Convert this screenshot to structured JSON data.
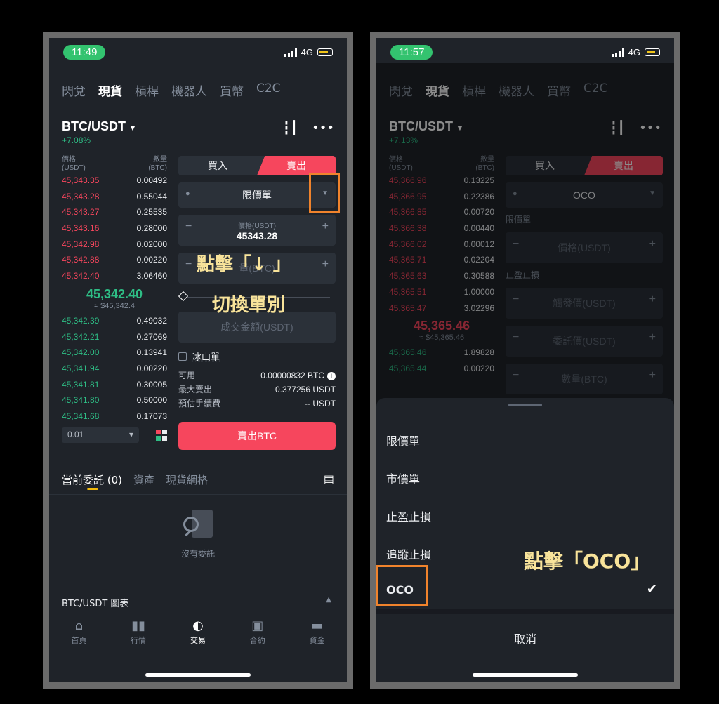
{
  "left": {
    "status": {
      "time": "11:49",
      "network": "4G"
    },
    "nav": [
      "閃兌",
      "現貨",
      "槓桿",
      "機器人",
      "買幣",
      "C2C"
    ],
    "pair": "BTC/USDT",
    "change": "+7.08%",
    "orderbook": {
      "price_header": "價格",
      "price_unit": "(USDT)",
      "qty_header": "數量",
      "qty_unit": "(BTC)",
      "asks": [
        {
          "p": "45,343.35",
          "q": "0.00492"
        },
        {
          "p": "45,343.28",
          "q": "0.55044"
        },
        {
          "p": "45,343.27",
          "q": "0.25535"
        },
        {
          "p": "45,343.16",
          "q": "0.28000"
        },
        {
          "p": "45,342.98",
          "q": "0.02000"
        },
        {
          "p": "45,342.88",
          "q": "0.00220"
        },
        {
          "p": "45,342.40",
          "q": "3.06460"
        }
      ],
      "mid_price": "45,342.40",
      "mid_usd": "≈ $45,342.4",
      "bids": [
        {
          "p": "45,342.39",
          "q": "0.49032"
        },
        {
          "p": "45,342.21",
          "q": "0.27069"
        },
        {
          "p": "45,342.00",
          "q": "0.13941"
        },
        {
          "p": "45,341.94",
          "q": "0.00220"
        },
        {
          "p": "45,341.81",
          "q": "0.30005"
        },
        {
          "p": "45,341.80",
          "q": "0.50000"
        },
        {
          "p": "45,341.68",
          "q": "0.17073"
        }
      ],
      "depth": "0.01"
    },
    "form": {
      "buy": "買入",
      "sell": "賣出",
      "order_type": "限價單",
      "price_label": "價格(USDT)",
      "price_value": "45343.28",
      "qty_placeholder": "量(BTC)",
      "total_placeholder": "成交金額(USDT)",
      "iceberg": "冰山單",
      "available_label": "可用",
      "available_value": "0.00000832 BTC",
      "max_sell_label": "最大賣出",
      "max_sell_value": "0.377256 USDT",
      "fee_label": "預估手續費",
      "fee_value": "-- USDT",
      "submit": "賣出BTC"
    },
    "orders_tabs": [
      "當前委託 (0)",
      "資產",
      "現貨網格"
    ],
    "empty_text": "沒有委託",
    "chart_bar": "BTC/USDT 圖表",
    "tabbar": [
      "首頁",
      "行情",
      "交易",
      "合約",
      "資金"
    ],
    "annotation_1": "點擊「↓ 」",
    "annotation_2": "切換單別"
  },
  "right": {
    "status": {
      "time": "11:57",
      "network": "4G"
    },
    "nav": [
      "閃兌",
      "現貨",
      "槓桿",
      "機器人",
      "買幣",
      "C2C"
    ],
    "pair": "BTC/USDT",
    "change": "+7.13%",
    "orderbook": {
      "price_header": "價格",
      "price_unit": "(USDT)",
      "qty_header": "數量",
      "qty_unit": "(BTC)",
      "asks": [
        {
          "p": "45,366.96",
          "q": "0.13225"
        },
        {
          "p": "45,366.95",
          "q": "0.22386"
        },
        {
          "p": "45,366.85",
          "q": "0.00720"
        },
        {
          "p": "45,366.38",
          "q": "0.00440"
        },
        {
          "p": "45,366.02",
          "q": "0.00012"
        },
        {
          "p": "45,365.71",
          "q": "0.02204"
        },
        {
          "p": "45,365.63",
          "q": "0.30588"
        },
        {
          "p": "45,365.51",
          "q": "1.00000"
        },
        {
          "p": "45,365.47",
          "q": "3.02296"
        }
      ],
      "mid_price": "45,365.46",
      "mid_usd": "≈ $45,365.46",
      "bids": [
        {
          "p": "45,365.46",
          "q": "1.89828"
        },
        {
          "p": "45,365.44",
          "q": "0.00220"
        }
      ]
    },
    "form": {
      "buy": "買入",
      "sell": "賣出",
      "order_type": "OCO",
      "limit_label": "限價單",
      "price_placeholder": "價格(USDT)",
      "tpsl_label": "止盈止損",
      "trigger_placeholder": "觸發價(USDT)",
      "order_price_placeholder": "委託價(USDT)",
      "qty_placeholder": "數量(BTC)"
    },
    "sheet": {
      "options": [
        "限價單",
        "市價單",
        "止盈止損",
        "追蹤止損",
        "OCO"
      ],
      "selected": "OCO",
      "cancel": "取消"
    },
    "annotation": "點擊「OCO」"
  }
}
